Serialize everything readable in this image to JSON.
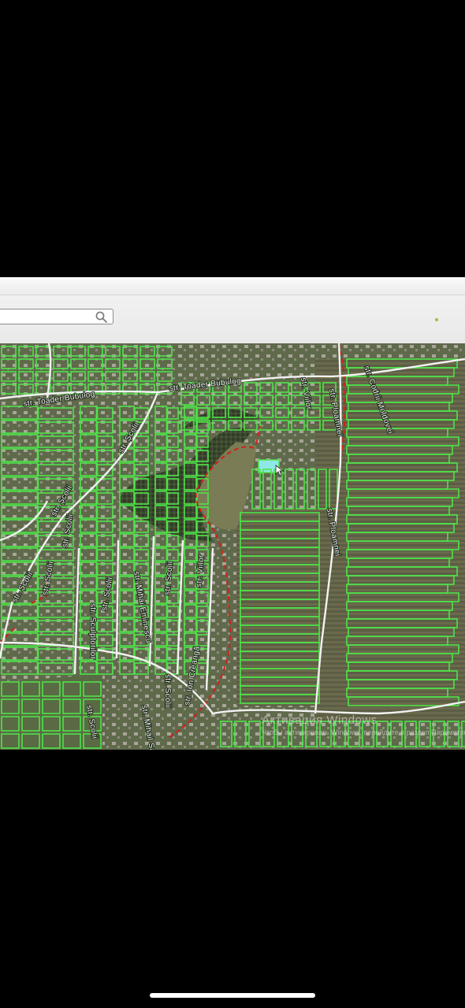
{
  "search": {
    "value": "",
    "placeholder": ""
  },
  "icons": {
    "search": "magnifier-icon",
    "cursor": "mouse-pointer-icon"
  },
  "map": {
    "streets": [
      "str. Toader Bubulog",
      "str. Toader Bubulog",
      "str. Codrii Moldovei",
      "str. Viilor",
      "str. Ploamnei",
      "str. Ploamnei",
      "str. Școlii",
      "str. Școlii",
      "str. Școlii",
      "str. Scolii",
      "str. Scolii",
      "str. Sculptorilor",
      "str. Mihai Eminescu",
      "str. Scolii",
      "str. Viilor",
      "str. Scolii",
      "str. Scolii",
      "str. Mihail Sadoveanu",
      "str. Ion Creangă",
      "str. Scolii"
    ],
    "colors": {
      "parcel_outline": "#4fe34a",
      "road": "#f2f2f2",
      "boundary": "#d0201a",
      "highlight": "#8fe8e8"
    }
  },
  "watermark": {
    "title": "Активация Windows",
    "subtitle": "Чтобы активировать Windows, перейдите в раздел Параметры."
  }
}
